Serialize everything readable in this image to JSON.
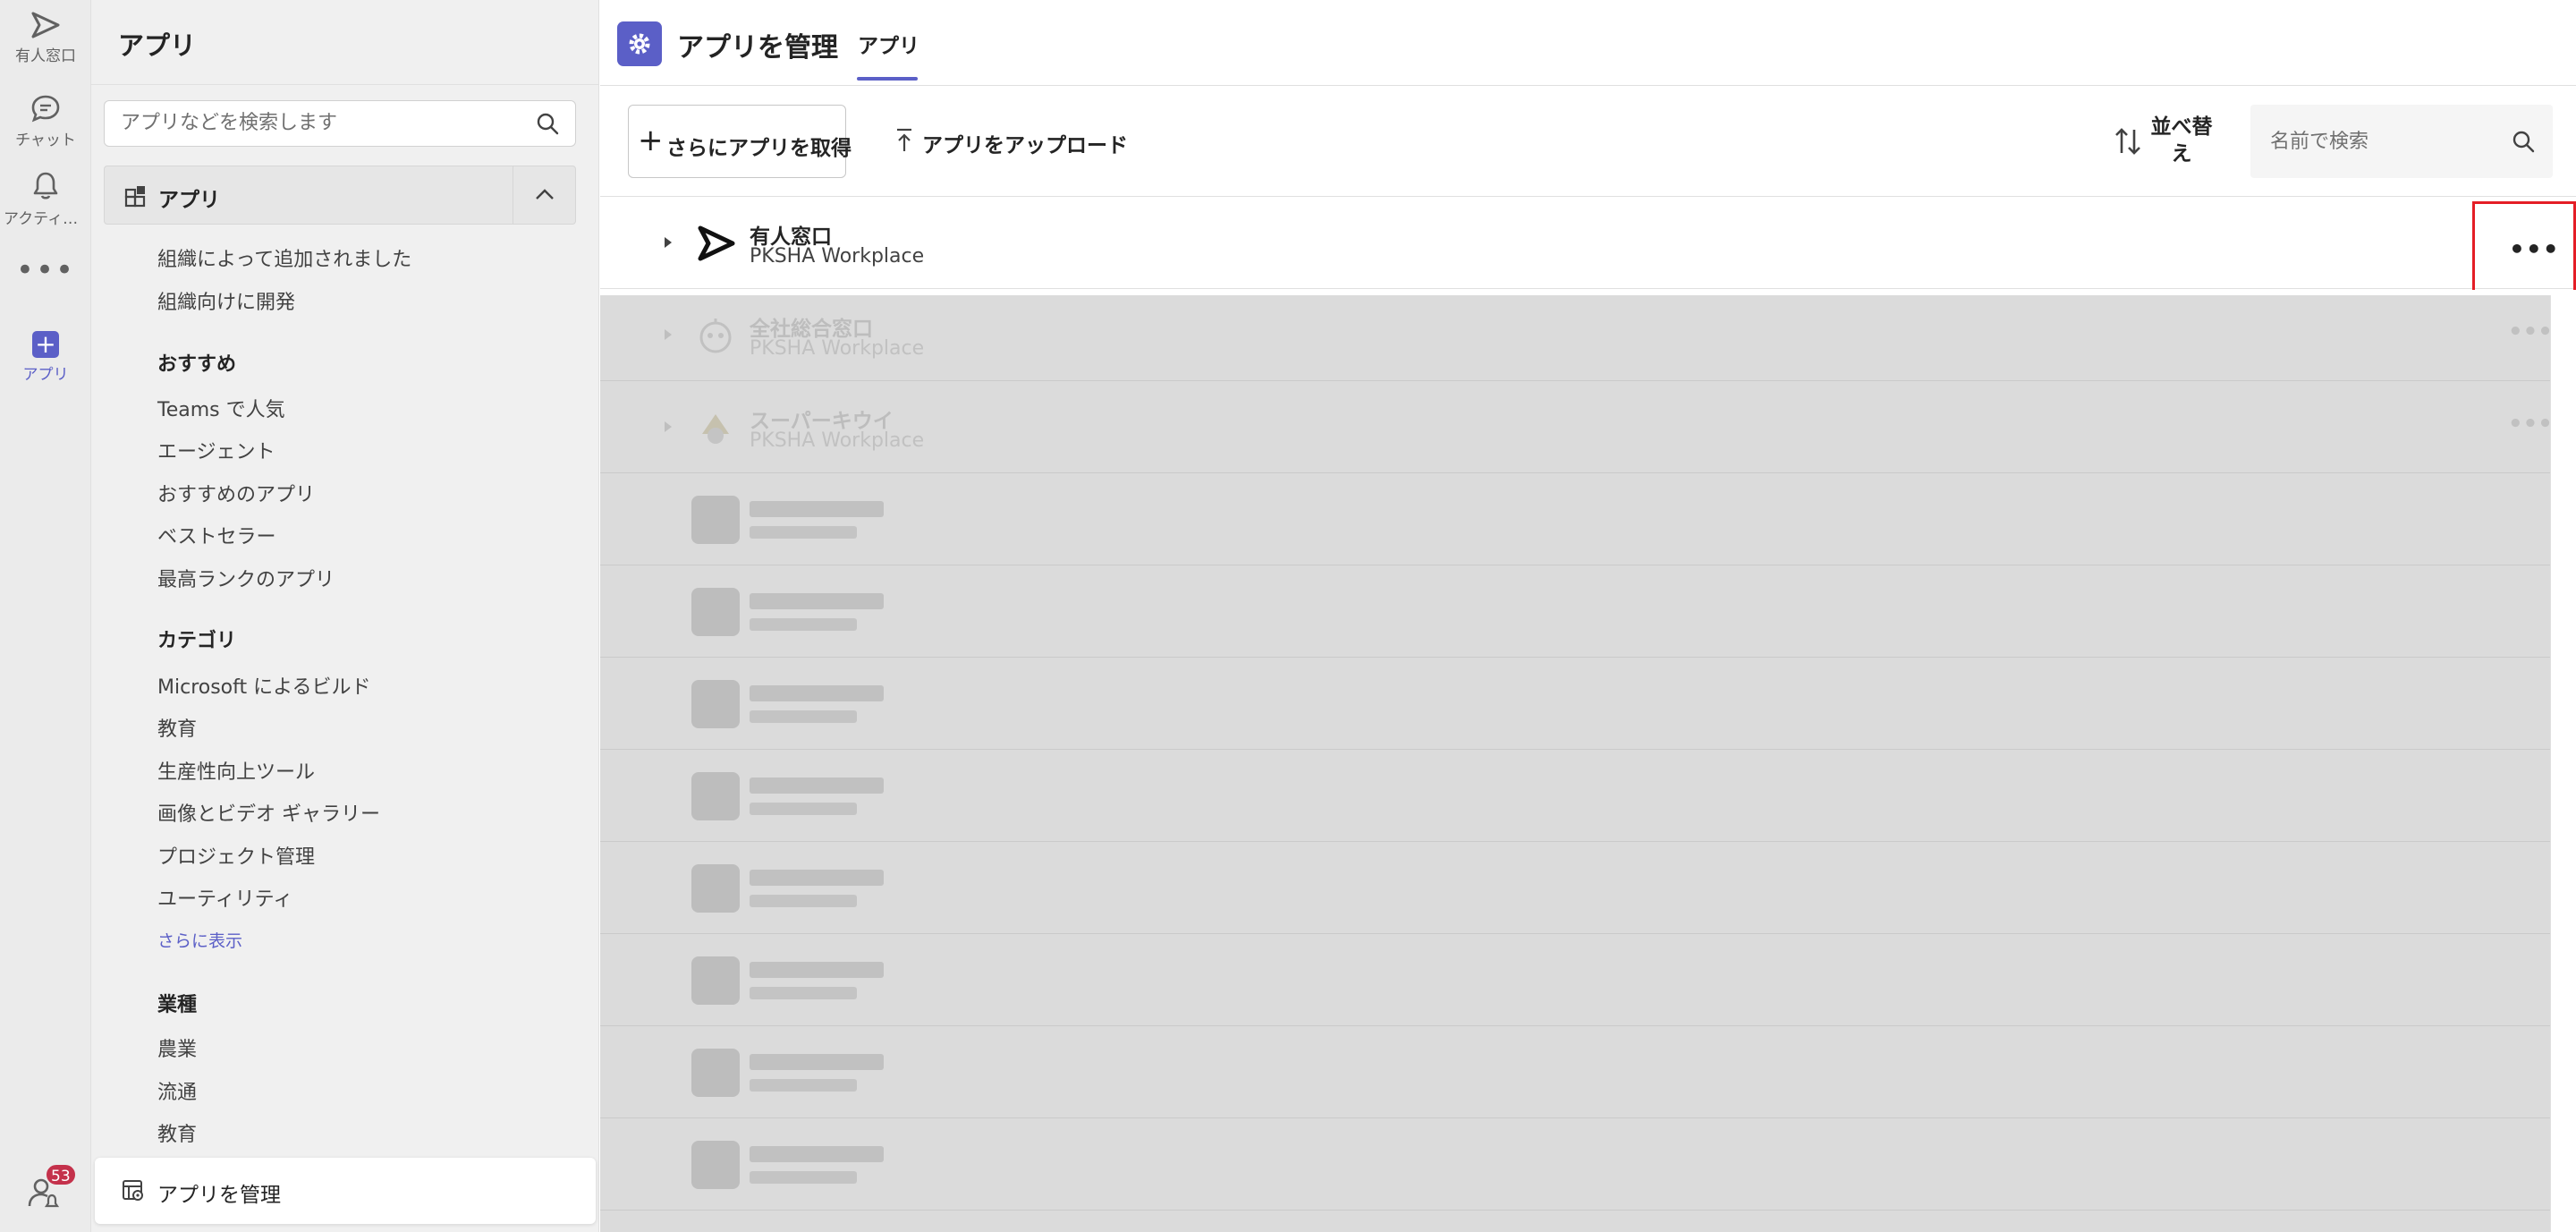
{
  "rail": {
    "items": [
      {
        "label": "有人窓口",
        "icon": "send-icon"
      },
      {
        "label": "チャット",
        "icon": "chat-icon"
      },
      {
        "label": "アクティビ…",
        "icon": "bell-icon"
      },
      {
        "label": "アプリ",
        "icon": "plus-icon"
      }
    ],
    "more": "•••",
    "badge": "53"
  },
  "sidebar": {
    "title": "アプリ",
    "search_placeholder": "アプリなどを検索します",
    "section_label": "アプリ",
    "org_items": [
      "組織によって追加されました",
      "組織向けに開発"
    ],
    "featured": {
      "heading": "おすすめ",
      "items": [
        "Teams で人気",
        "エージェント",
        "おすすめのアプリ",
        "ベストセラー",
        "最高ランクのアプリ"
      ]
    },
    "categories": {
      "heading": "カテゴリ",
      "items": [
        "Microsoft によるビルド",
        "教育",
        "生産性向上ツール",
        "画像とビデオ ギャラリー",
        "プロジェクト管理",
        "ユーティリティ"
      ],
      "show_more": "さらに表示"
    },
    "industries": {
      "heading": "業種",
      "items": [
        "農業",
        "流通",
        "教育"
      ]
    },
    "manage_label": "アプリを管理"
  },
  "header": {
    "title": "アプリを管理",
    "tab": "アプリ"
  },
  "toolbar": {
    "get_more": "さらにアプリを取得",
    "upload": "アプリをアップロード",
    "sort_line1": "並べ替",
    "sort_line2": "え",
    "search_placeholder": "名前で検索"
  },
  "apps": [
    {
      "name": "有人窓口",
      "publisher": "PKSHA Workplace",
      "more": "•••"
    },
    {
      "name": "全社総合窓口",
      "publisher": "PKSHA Workplace",
      "more": "•••"
    },
    {
      "name": "スーパーキウイ",
      "publisher": "PKSHA Workplace",
      "more": "•••"
    }
  ],
  "colors": {
    "accent": "#5b5fc7",
    "highlight": "#e41e26",
    "badge": "#c4314b"
  }
}
